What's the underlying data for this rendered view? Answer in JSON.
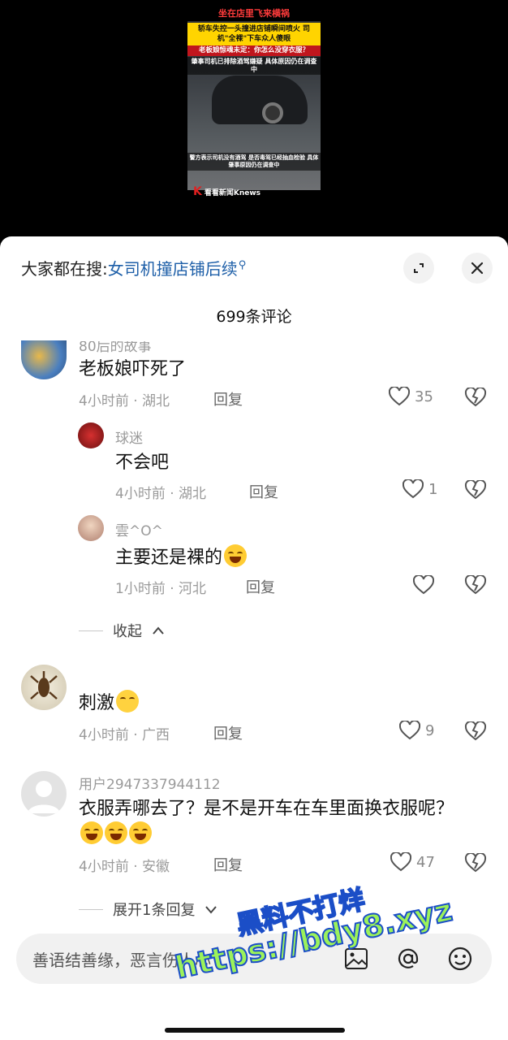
{
  "video": {
    "banner_top": "坐在店里飞来横祸",
    "banner_yellow": "轿车失控一头撞进店铺瞬间喷火 司机\"全裸\"下车众人傻眼",
    "banner_red": "老板娘惊魂未定：你怎么没穿衣服？",
    "banner_overlay": "肇事司机已排除酒驾嫌疑 具体原因仍在调查中",
    "banner_bottom": "警方表示司机没有酒驾 是否毒驾已经抽血检验 具体肇事原因仍在调查中",
    "logo": "看看新闻Knews",
    "logo_mark": "K"
  },
  "header": {
    "search_prefix": "大家都在搜:",
    "search_link": "女司机撞店铺后续",
    "comment_count": "699条评论"
  },
  "comments": [
    {
      "username": "80后的故事",
      "text": "老板娘吓死了",
      "time_loc": "4小时前 · 湖北",
      "reply_label": "回复",
      "likes": "35",
      "replies": [
        {
          "username": "球迷",
          "text": "不会吧",
          "time_loc": "4小时前 · 湖北",
          "reply_label": "回复",
          "likes": "1"
        },
        {
          "username": "雲^O^",
          "text": "主要还是裸的",
          "time_loc": "1小时前 · 河北",
          "reply_label": "回复",
          "likes": ""
        }
      ],
      "collapse_label": "收起"
    },
    {
      "username": "",
      "text": "刺激",
      "time_loc": "4小时前 · 广西",
      "reply_label": "回复",
      "likes": "9"
    },
    {
      "username": "用户2947337944112",
      "text": "衣服弄哪去了？是不是开车在车里面换衣服呢？",
      "time_loc": "4小时前 · 安徽",
      "reply_label": "回复",
      "likes": "47",
      "expand_label": "展开1条回复"
    }
  ],
  "input": {
    "placeholder": "善语结善缘，恶言伤人心"
  },
  "watermark": {
    "line1": "黑料不打烊",
    "line2": "https://bdy8.xyz"
  },
  "colors": {
    "link": "#1e5fa8",
    "meta": "#9a9a9a",
    "sheet_bg": "#ffffff"
  }
}
